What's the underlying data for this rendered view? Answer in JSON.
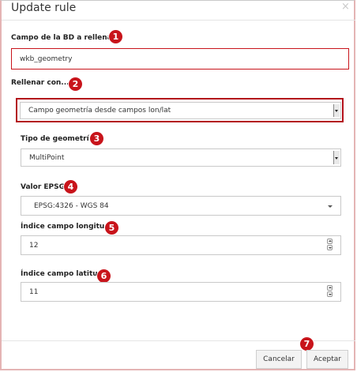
{
  "dialog": {
    "title": "Update rule",
    "close_glyph": "×"
  },
  "fields": {
    "campo_bd": {
      "label": "Campo de la BD a rellenar",
      "value": "wkb_geometry",
      "badge": "1"
    },
    "rellenar_con": {
      "label": "Rellenar con...",
      "value": "Campo geometría desde campos lon/lat",
      "badge": "2"
    },
    "tipo_geometria": {
      "label": "Tipo de geometría",
      "value": "MultiPoint",
      "badge": "3"
    },
    "valor_epsg": {
      "label": "Valor EPSG",
      "value": "EPSG:4326 - WGS 84",
      "badge": "4"
    },
    "indice_longitud": {
      "label": "Índice campo longitud",
      "value": "12",
      "badge": "5"
    },
    "indice_latitud": {
      "label": "Índice campo latitud",
      "value": "11",
      "badge": "6"
    }
  },
  "footer": {
    "cancel_label": "Cancelar",
    "accept_label": "Aceptar",
    "badge": "7"
  },
  "colors": {
    "highlight_red": "#b3101a",
    "badge_red": "#c8141b"
  },
  "icons": [
    "close-icon",
    "select-arrow-icon",
    "chevron-down-icon",
    "spinner-up-icon",
    "spinner-down-icon"
  ]
}
